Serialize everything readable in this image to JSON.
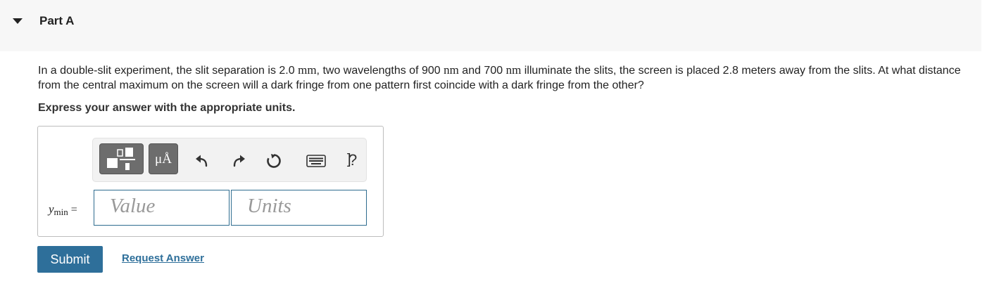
{
  "header": {
    "part_title": "Part A",
    "collapse_icon": "caret-down-icon"
  },
  "question": {
    "t1": "In a double-slit experiment, the slit separation is 2.0 ",
    "u1": "mm",
    "t2": ", two wavelengths of 900 ",
    "u2": "nm",
    "t3": " and 700 ",
    "u3": "nm",
    "t4": " illuminate the slits, the screen is placed 2.8 meters away from the slits. At what distance from the central maximum on the screen will a dark fringe from one pattern first coincide with a dark fringe from the other?"
  },
  "instruction": "Express your answer with the appropriate units.",
  "toolbar": {
    "units_label": "μÅ",
    "help_label": "?",
    "keyboard_label": "]",
    "icons": [
      "templates-icon",
      "units-icon",
      "undo-icon",
      "redo-icon",
      "reset-icon",
      "keyboard-icon",
      "help-icon"
    ]
  },
  "answer": {
    "var_symbol": "y",
    "var_sub": "min",
    "equals": " =",
    "value_placeholder": "Value",
    "units_placeholder": "Units"
  },
  "actions": {
    "submit_label": "Submit",
    "request_label": "Request Answer"
  },
  "colors": {
    "accent": "#2e6f9a",
    "header_bg": "#f7f7f7",
    "toolbar_button": "#6d6d6d"
  }
}
